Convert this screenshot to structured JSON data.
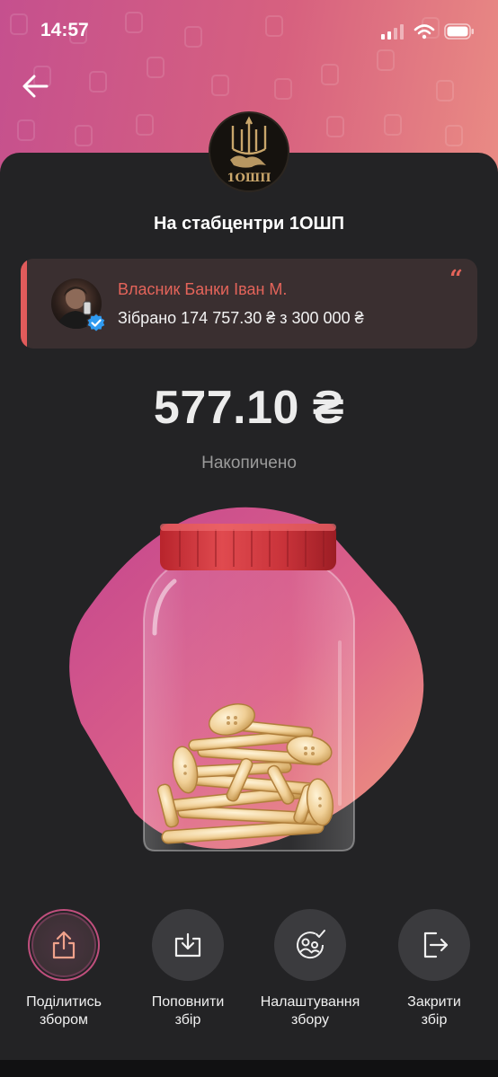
{
  "status_bar": {
    "time": "14:57"
  },
  "jar": {
    "title": "На стабцентри 1ОШП",
    "logo_text": "1ОШП",
    "amount": "577.10 ₴",
    "amount_caption": "Накопичено"
  },
  "owner": {
    "name": "Власник Банки Іван М.",
    "collected": "Зібрано 174 757.30 ₴ з 300 000 ₴",
    "quote_mark": "“"
  },
  "actions": [
    {
      "label": "Поділитись\nзбором",
      "icon": "share-icon"
    },
    {
      "label": "Поповнити\nзбір",
      "icon": "top-up-icon"
    },
    {
      "label": "Налаштування\nзбору",
      "icon": "settings-icon"
    },
    {
      "label": "Закрити\nзбір",
      "icon": "close-jar-icon"
    }
  ],
  "colors": {
    "accent": "#e15b5b",
    "header_gradient_start": "#c5508e",
    "header_gradient_end": "#ea8c84",
    "background": "#232325"
  }
}
